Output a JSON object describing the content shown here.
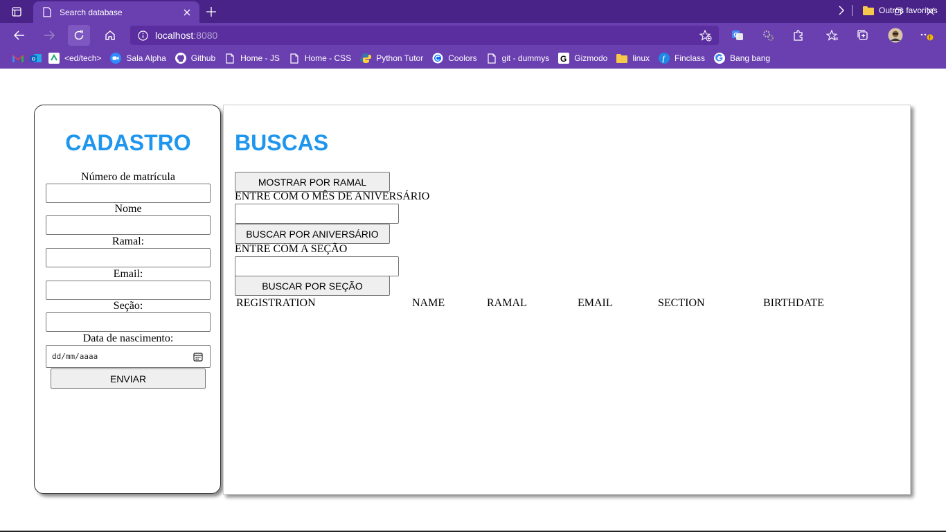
{
  "browser": {
    "tab_title": "Search database",
    "address": {
      "host": "localhost",
      "port": ":8080"
    },
    "bookmarks": [
      {
        "label": "",
        "icon": "gmail-icon"
      },
      {
        "label": "",
        "icon": "outlook-icon"
      },
      {
        "label": "<ed/tech>",
        "icon": "edtech-icon"
      },
      {
        "label": "Sala Alpha",
        "icon": "zoom-icon"
      },
      {
        "label": "Github",
        "icon": "github-icon"
      },
      {
        "label": "Home - JS",
        "icon": "page-icon"
      },
      {
        "label": "Home - CSS",
        "icon": "page-icon"
      },
      {
        "label": "Python Tutor",
        "icon": "python-icon"
      },
      {
        "label": "Coolors",
        "icon": "coolors-icon"
      },
      {
        "label": "git - dummys",
        "icon": "page-icon"
      },
      {
        "label": "Gizmodo",
        "icon": "gizmodo-icon"
      },
      {
        "label": "linux",
        "icon": "folder-icon"
      },
      {
        "label": "Finclass",
        "icon": "finclass-icon"
      },
      {
        "label": "Bang bang",
        "icon": "google-icon"
      }
    ],
    "other_favorites": "Outros favoritos"
  },
  "cadastro": {
    "title": "CADASTRO",
    "fields": [
      {
        "label": "Número de matrícula",
        "value": ""
      },
      {
        "label": "Nome",
        "value": ""
      },
      {
        "label": "Ramal:",
        "value": ""
      },
      {
        "label": "Email:",
        "value": ""
      },
      {
        "label": "Seção:",
        "value": ""
      },
      {
        "label": "Data de nascimento:",
        "placeholder": "dd/mm/aaaa"
      }
    ],
    "submit_label": "ENVIAR"
  },
  "buscas": {
    "title": "BUSCAS",
    "show_by_ramal_label": "MOSTRAR POR RAMAL",
    "month_prompt": "ENTRE COM O MÊS DE ANIVERSÁRIO",
    "month_value": "",
    "search_birthday_label": "BUSCAR POR ANIVERSÁRIO",
    "section_prompt": "ENTRE COM A SEÇÃO",
    "section_value": "",
    "search_section_label": "BUSCAR POR SEÇÃO",
    "table_headers": [
      "REGISTRATION",
      "NAME",
      "RAMAL",
      "EMAIL",
      "SECTION",
      "BIRTHDATE"
    ],
    "rows": []
  },
  "colors": {
    "title_blue": "#1e96ee",
    "chrome_purple": "#6a3fb0",
    "titlebar_purple": "#4a2389"
  }
}
